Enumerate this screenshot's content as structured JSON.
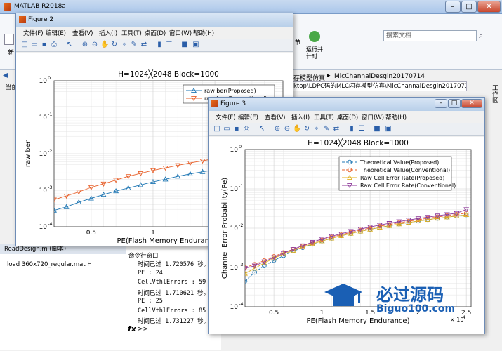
{
  "app": {
    "title": "MATLAB R2018a"
  },
  "ribbon": {
    "search_placeholder": "搜索文档",
    "new_label": "新",
    "section_label": "节",
    "run_advance_label": "运行并\n计时"
  },
  "address": {
    "breadcrumb_part": "存模型仿真",
    "current_folder": "MlcChannalDesgin20170714",
    "path": "ktop\\LDPC码的MLC闪存模型仿真\\MlcChannalDesgin20170714"
  },
  "left_panel": {
    "current_label": "当前",
    "file_label": "ReadDesign.m  (脚本)",
    "file_content": "load 360x720_regular.mat H"
  },
  "workspace_label": "工作区",
  "command_window": {
    "title": "命令行窗口",
    "lines": [
      "时间已过 1.720576 秒。",
      "PE : 24",
      "CellVthlErrors : 59",
      "时间已过 1.710621 秒。",
      "PE : 25",
      "CellVthlErrors : 85",
      "时间已过 1.731227 秒。"
    ],
    "prompt": ">>"
  },
  "figures": [
    {
      "title": "Figure 2",
      "menu": [
        "文件(F)",
        "编辑(E)",
        "查看(V)",
        "插入(I)",
        "工具(T)",
        "桌面(D)",
        "窗口(W)",
        "帮助(H)"
      ],
      "chart": {
        "title": "H=1024╳2048 Block=1000",
        "ylabel": "raw ber",
        "xlabel": "PE(Flash Memory Endurance)",
        "xticks": [
          "0.5",
          "1",
          "1.5"
        ],
        "yticks": [
          "10",
          "10",
          "10",
          "10",
          "10"
        ],
        "ytick_exp": [
          "0",
          "-1",
          "-2",
          "-3",
          "-4"
        ],
        "legend": [
          "raw ber(Proposed)",
          "raw ber(Conventional)"
        ]
      }
    },
    {
      "title": "Figure 3",
      "menu": [
        "文件(F)",
        "编辑(E)",
        "查看(V)",
        "插入(I)",
        "工具(T)",
        "桌面(D)",
        "窗口(W)",
        "帮助(H)"
      ],
      "chart": {
        "title": "H=1024╳2048 Block=1000",
        "ylabel": "Channel Error Probability(Pe)",
        "xlabel": "PE(Flash Memory Endurance)",
        "xticks": [
          "0.5",
          "1",
          "1.5",
          "2",
          "2.5"
        ],
        "x_multiplier": "× 10",
        "x_multiplier_exp": "4",
        "yticks": [
          "10",
          "10",
          "10",
          "10",
          "10"
        ],
        "ytick_exp": [
          "0",
          "-1",
          "-2",
          "-3",
          "-4"
        ],
        "legend": [
          "Theoretical Value(Proposed)",
          "Theoretical Value(Conventional)",
          "Raw Cell Error Rate(Proposed)",
          "Raw Cell Error Rate(Conventional)"
        ]
      }
    }
  ],
  "chart_data": [
    {
      "type": "line",
      "title": "H=1024╳2048 Block=1000",
      "xlabel": "PE(Flash Memory Endurance)",
      "ylabel": "raw ber",
      "yscale": "log",
      "ylim": [
        0.0001,
        1
      ],
      "x": [
        0.2,
        0.3,
        0.4,
        0.5,
        0.6,
        0.7,
        0.8,
        0.9,
        1.0,
        1.1,
        1.2,
        1.3,
        1.4,
        1.5,
        1.6,
        1.7,
        1.8,
        1.9,
        2.0
      ],
      "series": [
        {
          "name": "raw ber(Proposed)",
          "color": "#1f77b4",
          "marker": "triangle-up",
          "values": [
            0.00028,
            0.00035,
            0.00047,
            0.0006,
            0.00076,
            0.00095,
            0.00115,
            0.0014,
            0.0017,
            0.002,
            0.0024,
            0.0028,
            0.0032,
            0.0036,
            0.0041,
            0.0046,
            0.0052,
            0.0058,
            0.0064
          ]
        },
        {
          "name": "raw ber(Conventional)",
          "color": "#e8602a",
          "marker": "triangle-down",
          "values": [
            0.00055,
            0.0007,
            0.0009,
            0.0012,
            0.0015,
            0.0019,
            0.0024,
            0.0029,
            0.0035,
            0.0041,
            0.0048,
            0.0056,
            0.0064,
            0.0073,
            0.0082,
            0.0092,
            0.0103,
            0.0115,
            0.0128
          ]
        }
      ]
    },
    {
      "type": "line",
      "title": "H=1024╳2048 Block=1000",
      "xlabel": "PE(Flash Memory Endurance)",
      "ylabel": "Channel Error Probability(Pe)",
      "yscale": "log",
      "ylim": [
        0.0001,
        1
      ],
      "xlim": [
        0.2,
        2.5
      ],
      "x": [
        0.2,
        0.3,
        0.4,
        0.5,
        0.6,
        0.7,
        0.8,
        0.9,
        1.0,
        1.1,
        1.2,
        1.3,
        1.4,
        1.5,
        1.6,
        1.7,
        1.8,
        1.9,
        2.0,
        2.1,
        2.2,
        2.3,
        2.4,
        2.5
      ],
      "series": [
        {
          "name": "Theoretical Value(Proposed)",
          "color": "#1f77b4",
          "marker": "circle",
          "values": [
            0.00045,
            0.00075,
            0.0011,
            0.0015,
            0.002,
            0.0026,
            0.0032,
            0.0039,
            0.0047,
            0.0055,
            0.0064,
            0.0073,
            0.0083,
            0.0093,
            0.0104,
            0.0115,
            0.0127,
            0.0139,
            0.0151,
            0.0164,
            0.0177,
            0.019,
            0.0204,
            0.0218
          ]
        },
        {
          "name": "Theoretical Value(Conventional)",
          "color": "#e8602a",
          "marker": "circle",
          "values": [
            0.001,
            0.0012,
            0.0015,
            0.0019,
            0.0024,
            0.0029,
            0.0035,
            0.0042,
            0.005,
            0.0059,
            0.0068,
            0.0078,
            0.0089,
            0.01,
            0.0112,
            0.0124,
            0.0137,
            0.015,
            0.0164,
            0.0178,
            0.0193,
            0.0208,
            0.0224,
            0.024
          ]
        },
        {
          "name": "Raw Cell Error Rate(Proposed)",
          "color": "#e0b020",
          "marker": "triangle-up",
          "values": [
            0.0007,
            0.00095,
            0.0013,
            0.0017,
            0.0022,
            0.0027,
            0.0033,
            0.004,
            0.0047,
            0.0055,
            0.0064,
            0.0073,
            0.0083,
            0.0093,
            0.0104,
            0.0115,
            0.0127,
            0.0139,
            0.0151,
            0.0164,
            0.0177,
            0.019,
            0.0204,
            0.0218
          ]
        },
        {
          "name": "Raw Cell Error Rate(Conventional)",
          "color": "#8e3a9a",
          "marker": "triangle-down",
          "values": [
            0.00095,
            0.0011,
            0.0014,
            0.0018,
            0.0023,
            0.0029,
            0.0036,
            0.0044,
            0.0053,
            0.0062,
            0.0072,
            0.0083,
            0.0095,
            0.0107,
            0.012,
            0.0133,
            0.0147,
            0.0161,
            0.0176,
            0.0191,
            0.0207,
            0.0223,
            0.024,
            0.0298
          ]
        }
      ]
    }
  ],
  "watermark": {
    "brand": "必过源码",
    "url": "Biguo100.com"
  }
}
